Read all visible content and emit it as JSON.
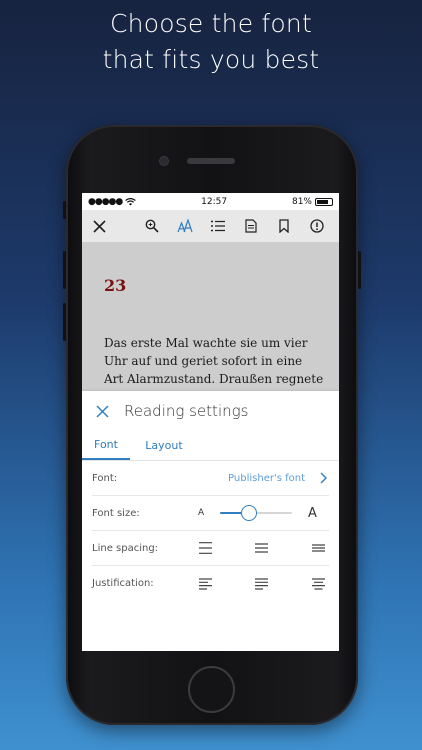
{
  "headline": {
    "line1": "Choose the font",
    "line2": "that fits you best"
  },
  "status": {
    "time": "12:57",
    "battery": "81%",
    "battery_level": 0.81
  },
  "toolbar": {
    "icons": [
      "close-icon",
      "search-icon",
      "font-icon",
      "list-icon",
      "document-icon",
      "bookmark-icon",
      "info-icon"
    ]
  },
  "reader": {
    "chapter": "23",
    "lines": [
      "Das erste Mal wachte sie um vier",
      "Uhr auf und geriet sofort in eine",
      "Art Alarmzustand. Draußen regnete"
    ]
  },
  "settings": {
    "title": "Reading settings",
    "tabs": [
      {
        "label": "Font",
        "active": true
      },
      {
        "label": "Layout",
        "active": false
      }
    ],
    "font": {
      "label": "Font:",
      "value": "Publisher's font"
    },
    "font_size": {
      "label": "Font size:",
      "small": "A",
      "large": "A",
      "level": 0.37
    },
    "line_spacing": {
      "label": "Line spacing:"
    },
    "justification": {
      "label": "Justification:"
    }
  },
  "colors": {
    "accent": "#2f7fc1",
    "link": "#5b9fd6",
    "chapter": "#7a1212"
  }
}
